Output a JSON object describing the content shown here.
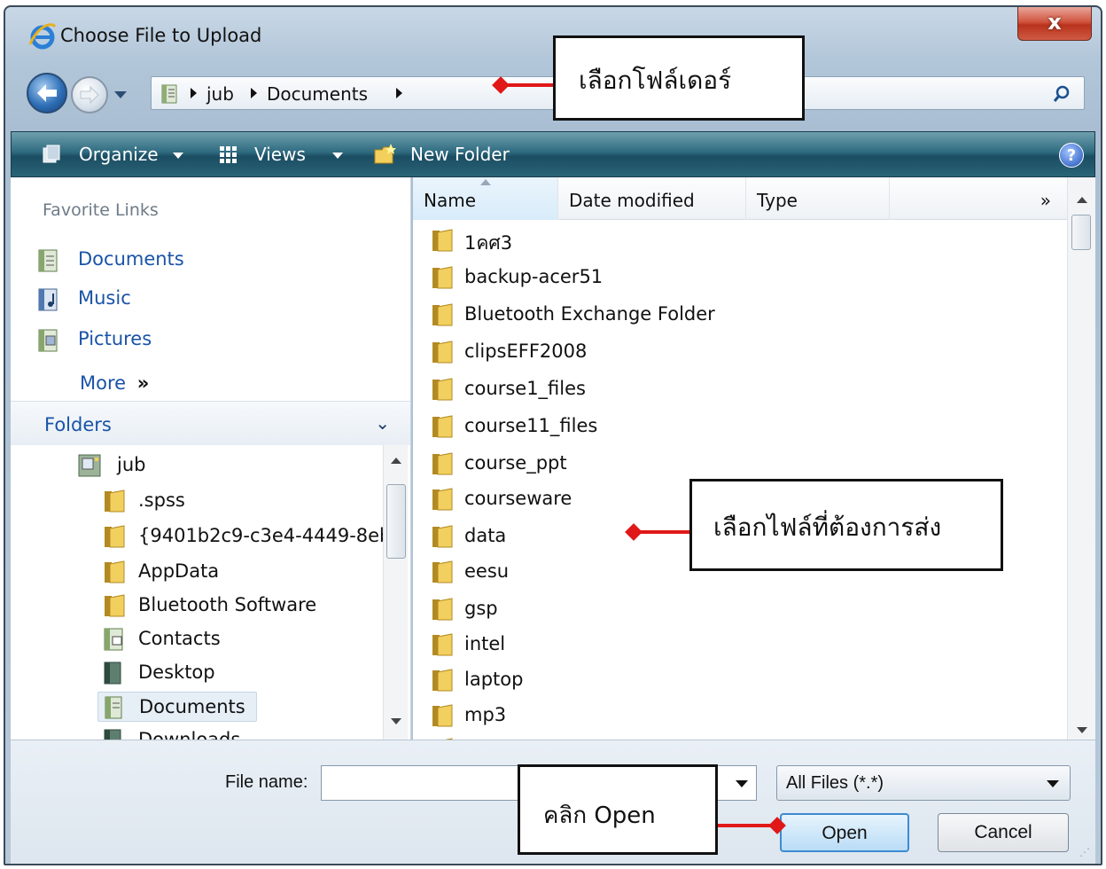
{
  "window": {
    "title": "Choose File to Upload",
    "close_label": "x"
  },
  "address": {
    "crumbs": [
      "jub",
      "Documents"
    ]
  },
  "toolbar": {
    "organize": "Organize",
    "views": "Views",
    "new_folder": "New Folder",
    "help": "?"
  },
  "favorites": {
    "title": "Favorite Links",
    "items": [
      {
        "label": "Documents",
        "icon": "documents-icon"
      },
      {
        "label": "Music",
        "icon": "music-icon"
      },
      {
        "label": "Pictures",
        "icon": "pictures-icon"
      }
    ],
    "more": "More",
    "more_glyph": "»"
  },
  "folders": {
    "title": "Folders",
    "chevron": "⌄",
    "tree": [
      {
        "label": "jub",
        "icon": "user-folder-icon",
        "level": 0
      },
      {
        "label": ".spss",
        "icon": "folder-icon",
        "level": 1
      },
      {
        "label": "{9401b2c9-c3e4-4449-8eb",
        "icon": "folder-icon",
        "level": 1
      },
      {
        "label": "AppData",
        "icon": "folder-icon",
        "level": 1
      },
      {
        "label": "Bluetooth Software",
        "icon": "folder-icon",
        "level": 1
      },
      {
        "label": "Contacts",
        "icon": "contacts-icon",
        "level": 1
      },
      {
        "label": "Desktop",
        "icon": "desktop-icon",
        "level": 1
      },
      {
        "label": "Documents",
        "icon": "documents-icon",
        "level": 1,
        "selected": true
      },
      {
        "label": "Downloads",
        "icon": "downloads-icon",
        "level": 1
      }
    ]
  },
  "columns": [
    "Name",
    "Date modified",
    "Type"
  ],
  "columns_more": "»",
  "files": [
    "1คศ3",
    "backup-acer51",
    "Bluetooth Exchange Folder",
    "clipsEFF2008",
    "course1_files",
    "course11_files",
    "course_ppt",
    "courseware",
    "data",
    "eesu",
    "gsp",
    "intel",
    "laptop",
    "mp3",
    "..."
  ],
  "bottom": {
    "file_name_label": "File name:",
    "file_name_value": "",
    "filter": "All Files (*.*)",
    "open": "Open",
    "cancel": "Cancel"
  },
  "annotations": {
    "folder_note": "เลือกโฟล์เดอร์",
    "file_note": "เลือกไฟล์ที่ต้องการส่ง",
    "open_note": "คลิก Open"
  },
  "colors": {
    "accent": "#1a53a8",
    "annotation_arrow": "#e01818",
    "toolbar": "#2f6b80"
  }
}
